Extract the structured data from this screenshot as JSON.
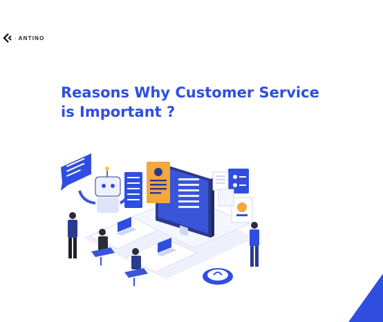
{
  "brand": {
    "name": "ANTINO",
    "color": "#1c1c1c"
  },
  "headline": {
    "line1": "Reasons Why Customer Service",
    "line2": "is Important ?",
    "color": "#2f4ee0"
  },
  "illustration": {
    "icons": [
      "chat-bubble-icon",
      "robot-icon",
      "monitor-icon",
      "id-card-icon",
      "headset-support-icon",
      "desk-icon"
    ]
  },
  "accent": {
    "color": "#2f4ee0"
  }
}
